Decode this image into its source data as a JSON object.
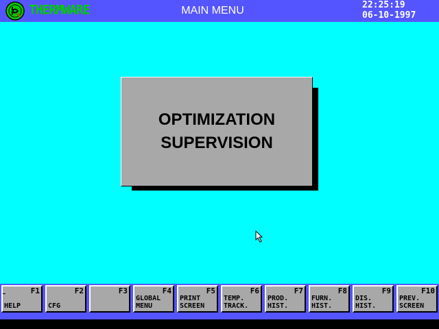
{
  "header": {
    "logo_text": "THERMWARE",
    "title": "MAIN MENU",
    "time": "22:25:19",
    "date": "06-10-1997"
  },
  "menu": {
    "line1": "OPTIMIZATION",
    "line2": "SUPERVISION"
  },
  "function_keys": [
    {
      "key": "F1",
      "line1": "",
      "line2": "HELP"
    },
    {
      "key": "F2",
      "line1": "",
      "line2": "CFG"
    },
    {
      "key": "F3",
      "line1": "",
      "line2": ""
    },
    {
      "key": "F4",
      "line1": "GLOBAL",
      "line2": "MENU"
    },
    {
      "key": "F5",
      "line1": "PRINT",
      "line2": "SCREEN"
    },
    {
      "key": "F6",
      "line1": "TEMP.",
      "line2": "TRACK."
    },
    {
      "key": "F7",
      "line1": "PROD.",
      "line2": "HIST."
    },
    {
      "key": "F8",
      "line1": "FURN.",
      "line2": "HIST."
    },
    {
      "key": "F9",
      "line1": "DIS.",
      "line2": "HIST."
    },
    {
      "key": "F10",
      "line1": "PREV.",
      "line2": "SCREEN"
    }
  ],
  "colors": {
    "background": "#00ffff",
    "bar": "#5555ff",
    "panel": "#a8a8a8",
    "logo": "#00cc00"
  }
}
